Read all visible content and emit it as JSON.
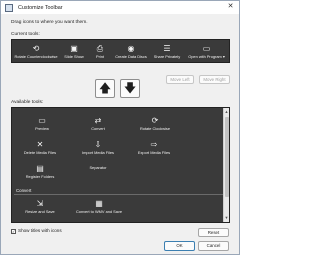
{
  "window": {
    "title": "Customize Toolbar"
  },
  "instructions": "Drag icons to where you want them.",
  "current_tools": {
    "label": "Current tools:",
    "items": [
      {
        "icon": "rotate-counterclockwise-icon",
        "glyph": "⟲",
        "label": "Rotate Counterclockwise"
      },
      {
        "icon": "slideshow-icon",
        "glyph": "▣",
        "label": "Slide Show"
      },
      {
        "icon": "print-icon",
        "glyph": "⎙",
        "label": "Print"
      },
      {
        "icon": "disc-icon",
        "glyph": "◉",
        "label": "Create Data Discs"
      },
      {
        "icon": "share-icon",
        "glyph": "☰",
        "label": "Share Privately"
      },
      {
        "icon": "open-with-icon",
        "glyph": "▭",
        "label": "Open with Program ▾"
      }
    ]
  },
  "buttons": {
    "move_left": "Move Left",
    "move_right": "Move Right",
    "up_arrow": "🡅",
    "down_arrow": "🡇",
    "reset": "Reset",
    "ok": "OK",
    "cancel": "Cancel"
  },
  "available_tools": {
    "label": "Available tools:",
    "items": [
      {
        "icon": "preview-icon",
        "glyph": "▭",
        "label": "Preview"
      },
      {
        "icon": "convert-icon",
        "glyph": "⇄",
        "label": "Convert"
      },
      {
        "icon": "rotate-clockwise-icon",
        "glyph": "⟳",
        "label": "Rotate Clockwise"
      },
      {
        "icon": "delete-icon",
        "glyph": "✕",
        "label": "Delete Media Files"
      },
      {
        "icon": "import-icon",
        "glyph": "⇩",
        "label": "Import Media Files"
      },
      {
        "icon": "export-icon",
        "glyph": "⇨",
        "label": "Export Media Files"
      },
      {
        "icon": "register-folders-icon",
        "glyph": "▤",
        "label": "Register Folders"
      },
      {
        "icon": "separator-icon",
        "glyph": "",
        "label": "Separator"
      }
    ],
    "group_label": "Convert",
    "group_items": [
      {
        "icon": "resize-save-icon",
        "glyph": "⇲",
        "label": "Resize and Save"
      },
      {
        "icon": "convert-wmv-icon",
        "glyph": "▦",
        "label": "Convert to WMV and Save"
      }
    ]
  },
  "options": {
    "show_titles_label": "Show titles with icons",
    "show_titles_checked": "✓"
  }
}
